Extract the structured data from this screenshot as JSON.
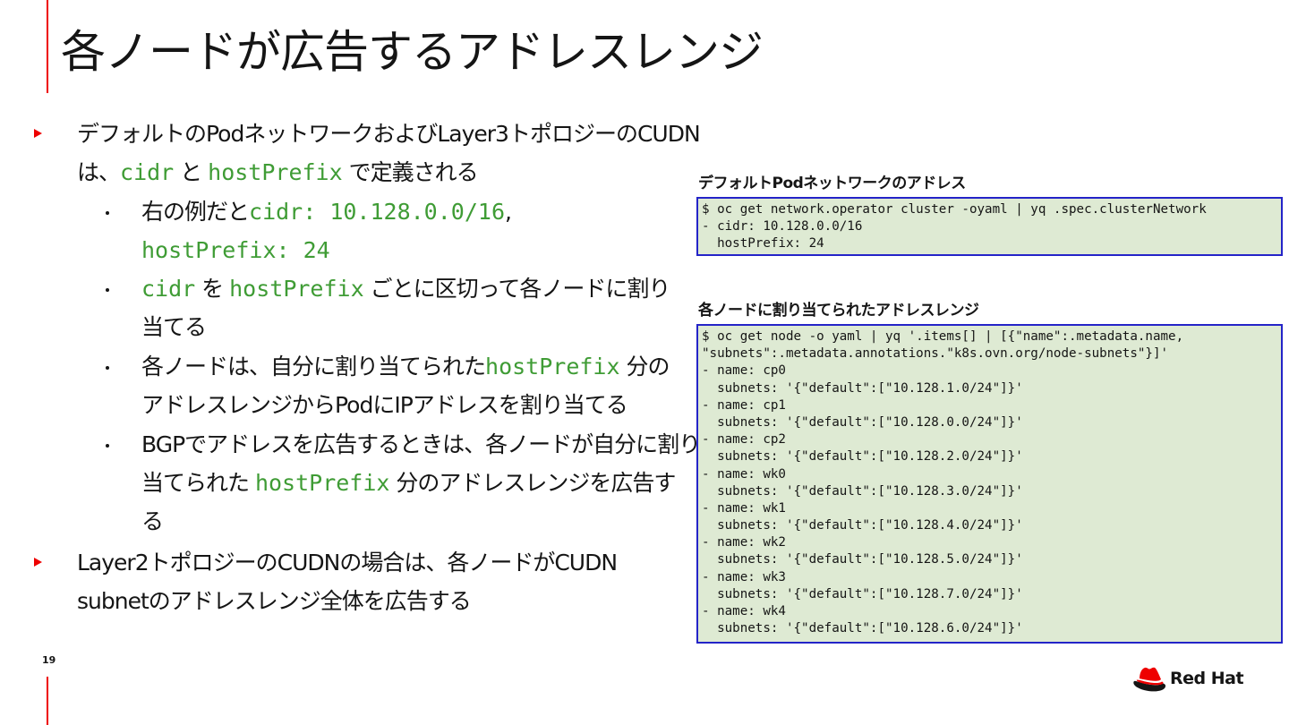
{
  "slide": {
    "title": "各ノードが広告するアドレスレンジ",
    "page_number": "19",
    "accent_color": "#ee0000",
    "code_color": "#3f9c35",
    "logo_text": "Red Hat"
  },
  "bullets": [
    {
      "level": 1,
      "line1_prefix": "デフォルトのPodネットワークおよびLayer3トポロジーのCUDN",
      "line2_prefix": "は、",
      "code_a": "cidr",
      "mid": " と ",
      "code_b": "hostPrefix",
      "suffix": " で定義される"
    },
    {
      "level": 2,
      "prefix": "右の例だと",
      "code_a": "cidr: 10.128.0.0/16",
      "mid": ",",
      "code_b": "hostPrefix: 24"
    },
    {
      "level": 2,
      "code_a": "cidr",
      "mid": " を ",
      "code_b": "hostPrefix",
      "suffix_line1": " ごとに区切って各ノードに割り",
      "suffix_line2": "当てる"
    },
    {
      "level": 2,
      "prefix": "各ノードは、自分に割り当てられた",
      "code_a": "hostPrefix",
      "suffix_line1": " 分の",
      "line2": "アドレスレンジからPodにIPアドレスを割り当てる"
    },
    {
      "level": 2,
      "line1": "BGPでアドレスを広告するときは、各ノードが自分に割り",
      "line2_prefix": "当てられた ",
      "code_a": "hostPrefix",
      "line2_suffix": " 分のアドレスレンジを広告す",
      "line3": "る"
    },
    {
      "level": 1,
      "line1": "Layer2トポロジーのCUDNの場合は、各ノードがCUDN",
      "line2": "subnetのアドレスレンジ全体を広告する"
    }
  ],
  "code_blocks": [
    {
      "heading": "デフォルトPodネットワークのアドレス",
      "lines": [
        "$ oc get network.operator cluster -oyaml | yq .spec.clusterNetwork",
        "- cidr: 10.128.0.0/16",
        "  hostPrefix: 24"
      ]
    },
    {
      "heading": "各ノードに割り当てられたアドレスレンジ",
      "lines": [
        "$ oc get node -o yaml | yq '.items[] | [{\"name\":.metadata.name,",
        "\"subnets\":.metadata.annotations.\"k8s.ovn.org/node-subnets\"}]'",
        "- name: cp0",
        "  subnets: '{\"default\":[\"10.128.1.0/24\"]}'",
        "- name: cp1",
        "  subnets: '{\"default\":[\"10.128.0.0/24\"]}'",
        "- name: cp2",
        "  subnets: '{\"default\":[\"10.128.2.0/24\"]}'",
        "- name: wk0",
        "  subnets: '{\"default\":[\"10.128.3.0/24\"]}'",
        "- name: wk1",
        "  subnets: '{\"default\":[\"10.128.4.0/24\"]}'",
        "- name: wk2",
        "  subnets: '{\"default\":[\"10.128.5.0/24\"]}'",
        "- name: wk3",
        "  subnets: '{\"default\":[\"10.128.7.0/24\"]}'",
        "- name: wk4",
        "  subnets: '{\"default\":[\"10.128.6.0/24\"]}'"
      ]
    }
  ]
}
